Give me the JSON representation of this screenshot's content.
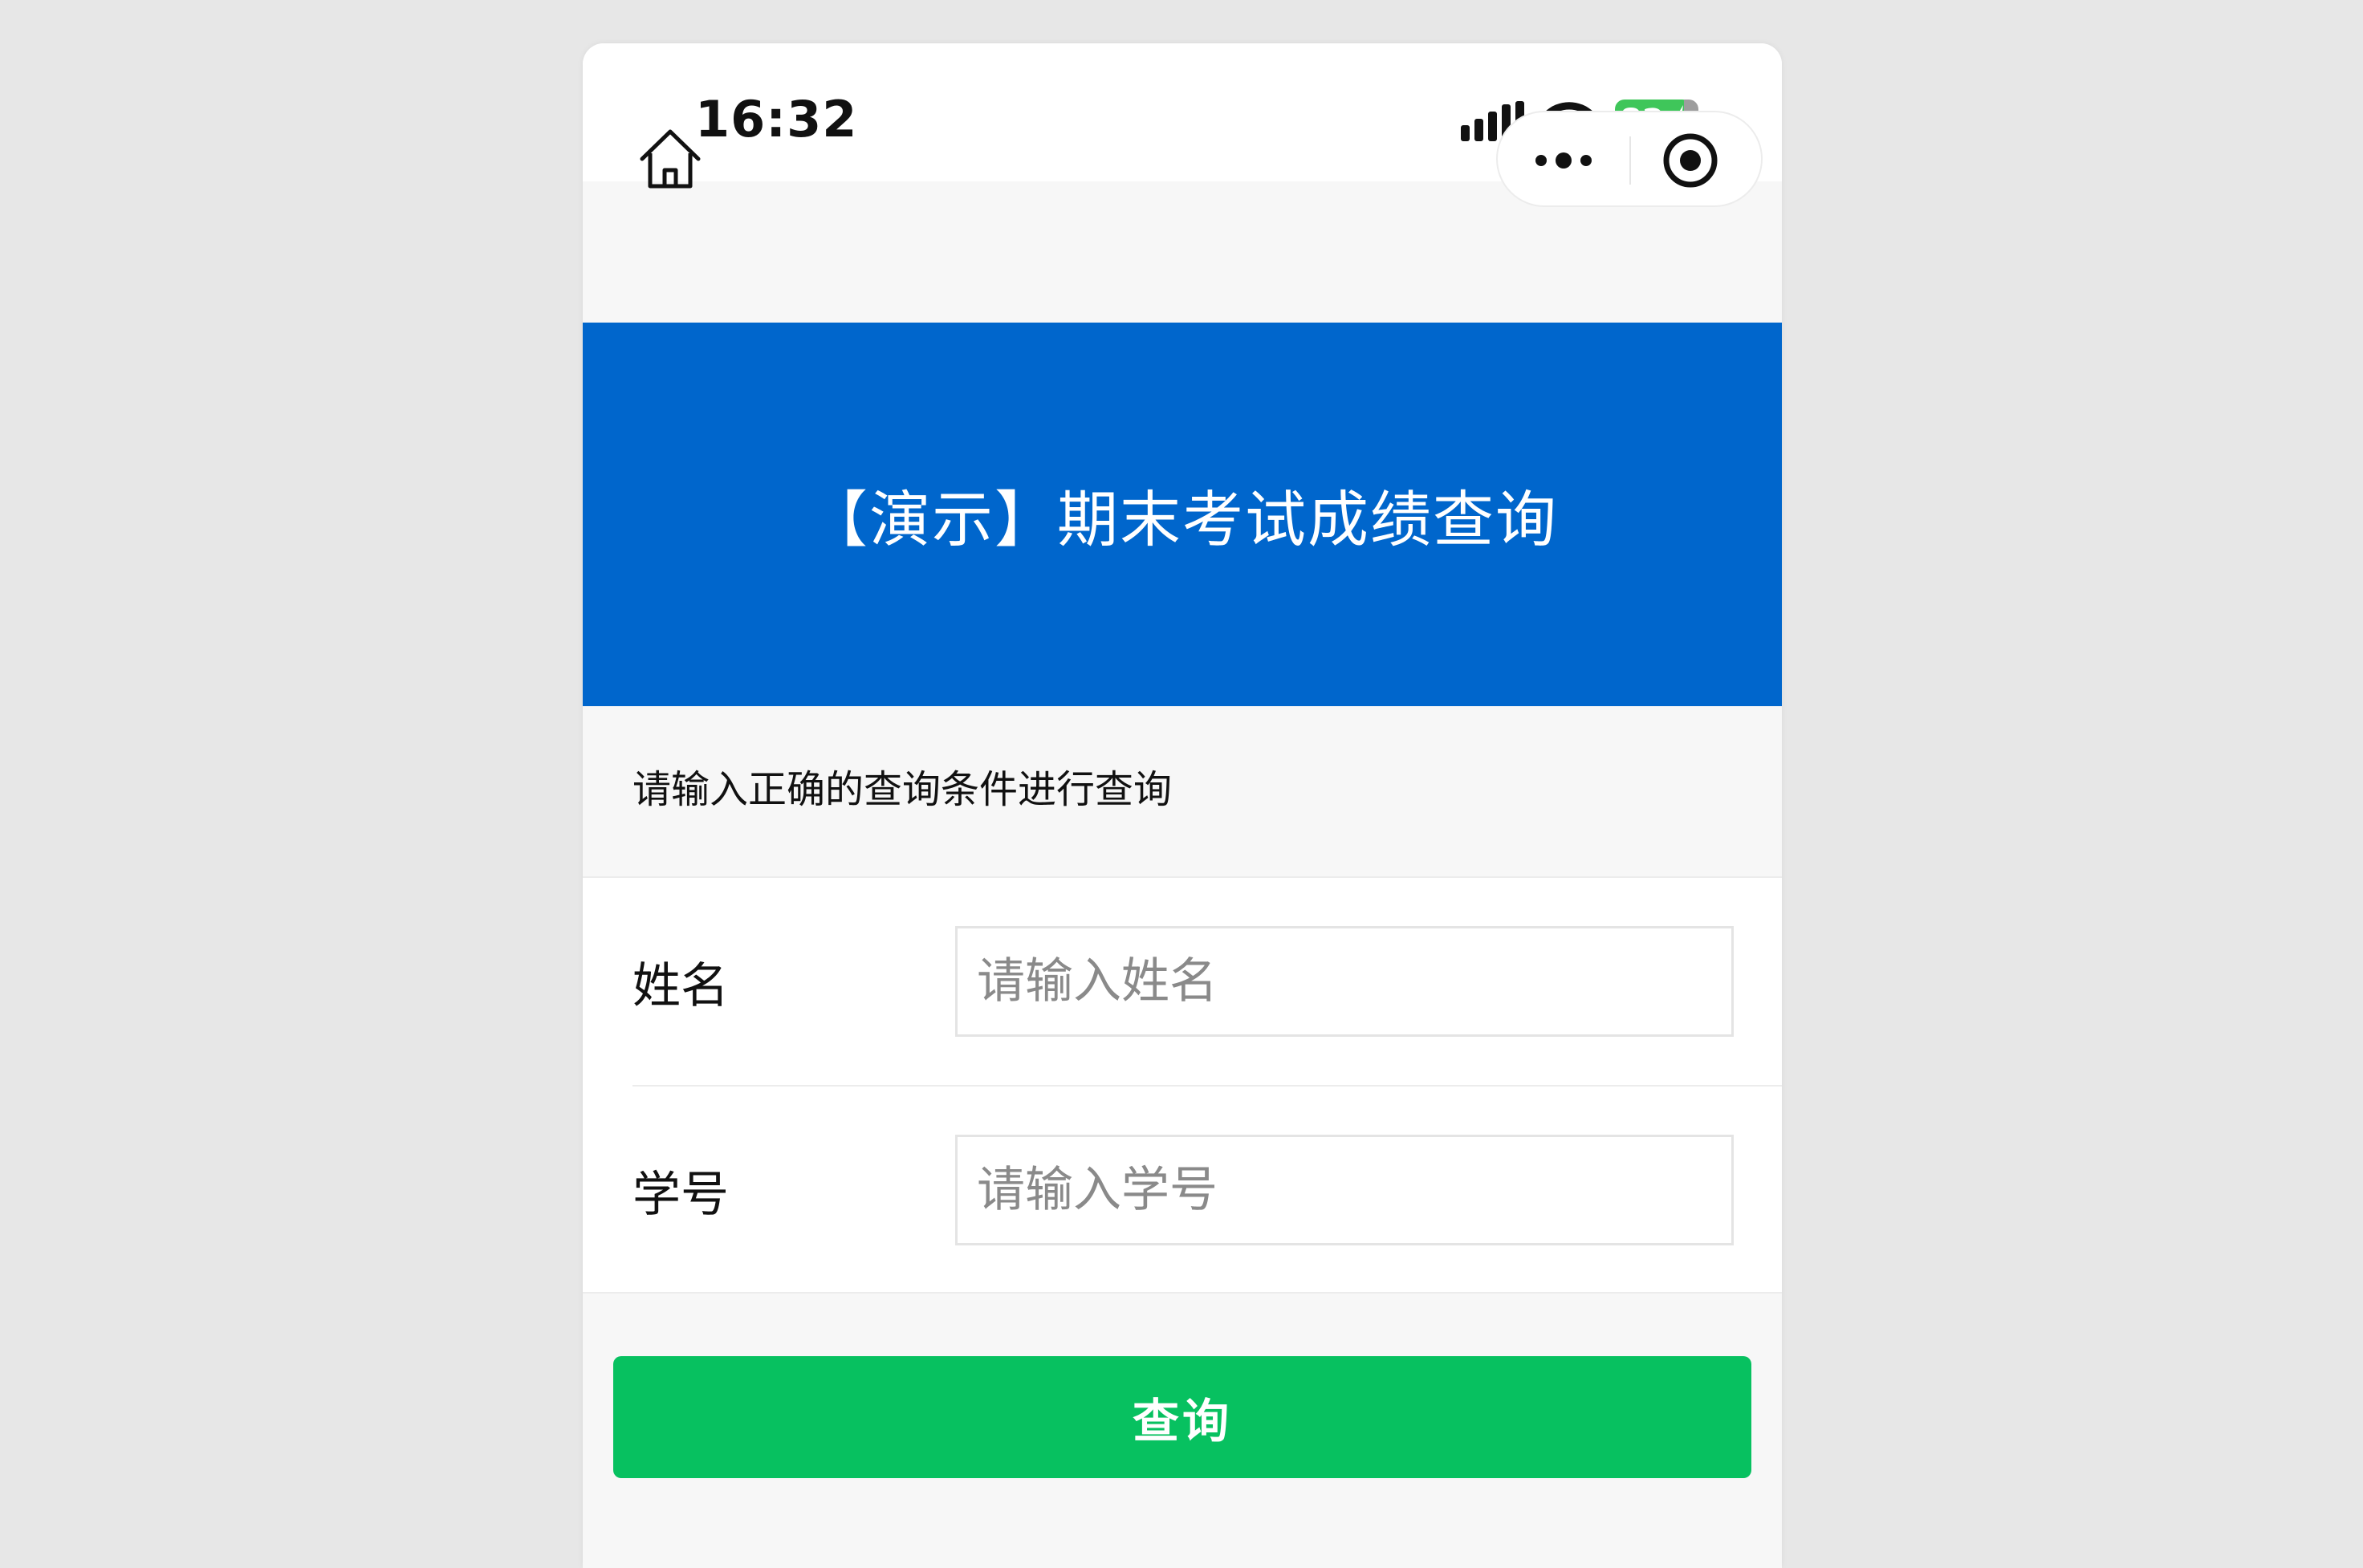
{
  "status_bar": {
    "time": "16:32",
    "battery": "82",
    "signal_icon": "cellular-signal-icon",
    "wifi_icon": "wifi-icon",
    "battery_icon": "battery-charging-icon"
  },
  "nav": {
    "home_icon": "home-icon",
    "more_icon": "more-dots-icon",
    "close_icon": "target-circle-icon"
  },
  "banner": {
    "title": "【演示】期末考试成绩查询",
    "color": "#0066cc"
  },
  "hint": "请输入正确的查询条件进行查询",
  "form": {
    "fields": [
      {
        "label": "姓名",
        "placeholder": "请输入姓名",
        "value": ""
      },
      {
        "label": "学号",
        "placeholder": "请输入学号",
        "value": ""
      }
    ]
  },
  "submit": {
    "label": "查询",
    "color": "#07c160"
  }
}
